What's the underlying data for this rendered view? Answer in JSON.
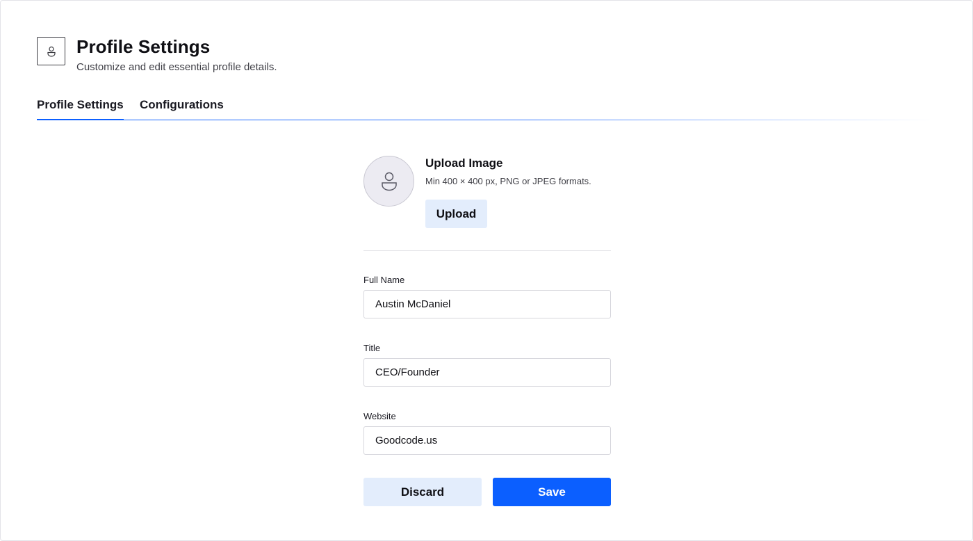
{
  "header": {
    "icon": "user-icon",
    "title": "Profile Settings",
    "subtitle": "Customize and edit essential profile details."
  },
  "tabs": [
    {
      "label": "Profile Settings",
      "active": true
    },
    {
      "label": "Configurations",
      "active": false
    }
  ],
  "upload": {
    "avatar_icon": "user-icon",
    "title": "Upload Image",
    "hint": "Min 400 × 400 px, PNG or JPEG formats.",
    "button_label": "Upload"
  },
  "form": {
    "full_name": {
      "label": "Full Name",
      "value": "Austin McDaniel"
    },
    "title": {
      "label": "Title",
      "value": "CEO/Founder"
    },
    "website": {
      "label": "Website",
      "value": "Goodcode.us"
    }
  },
  "actions": {
    "discard_label": "Discard",
    "save_label": "Save"
  },
  "colors": {
    "accent": "#0b5fff",
    "secondary_button": "#e3edfc",
    "avatar_bg": "#ecebf2"
  }
}
